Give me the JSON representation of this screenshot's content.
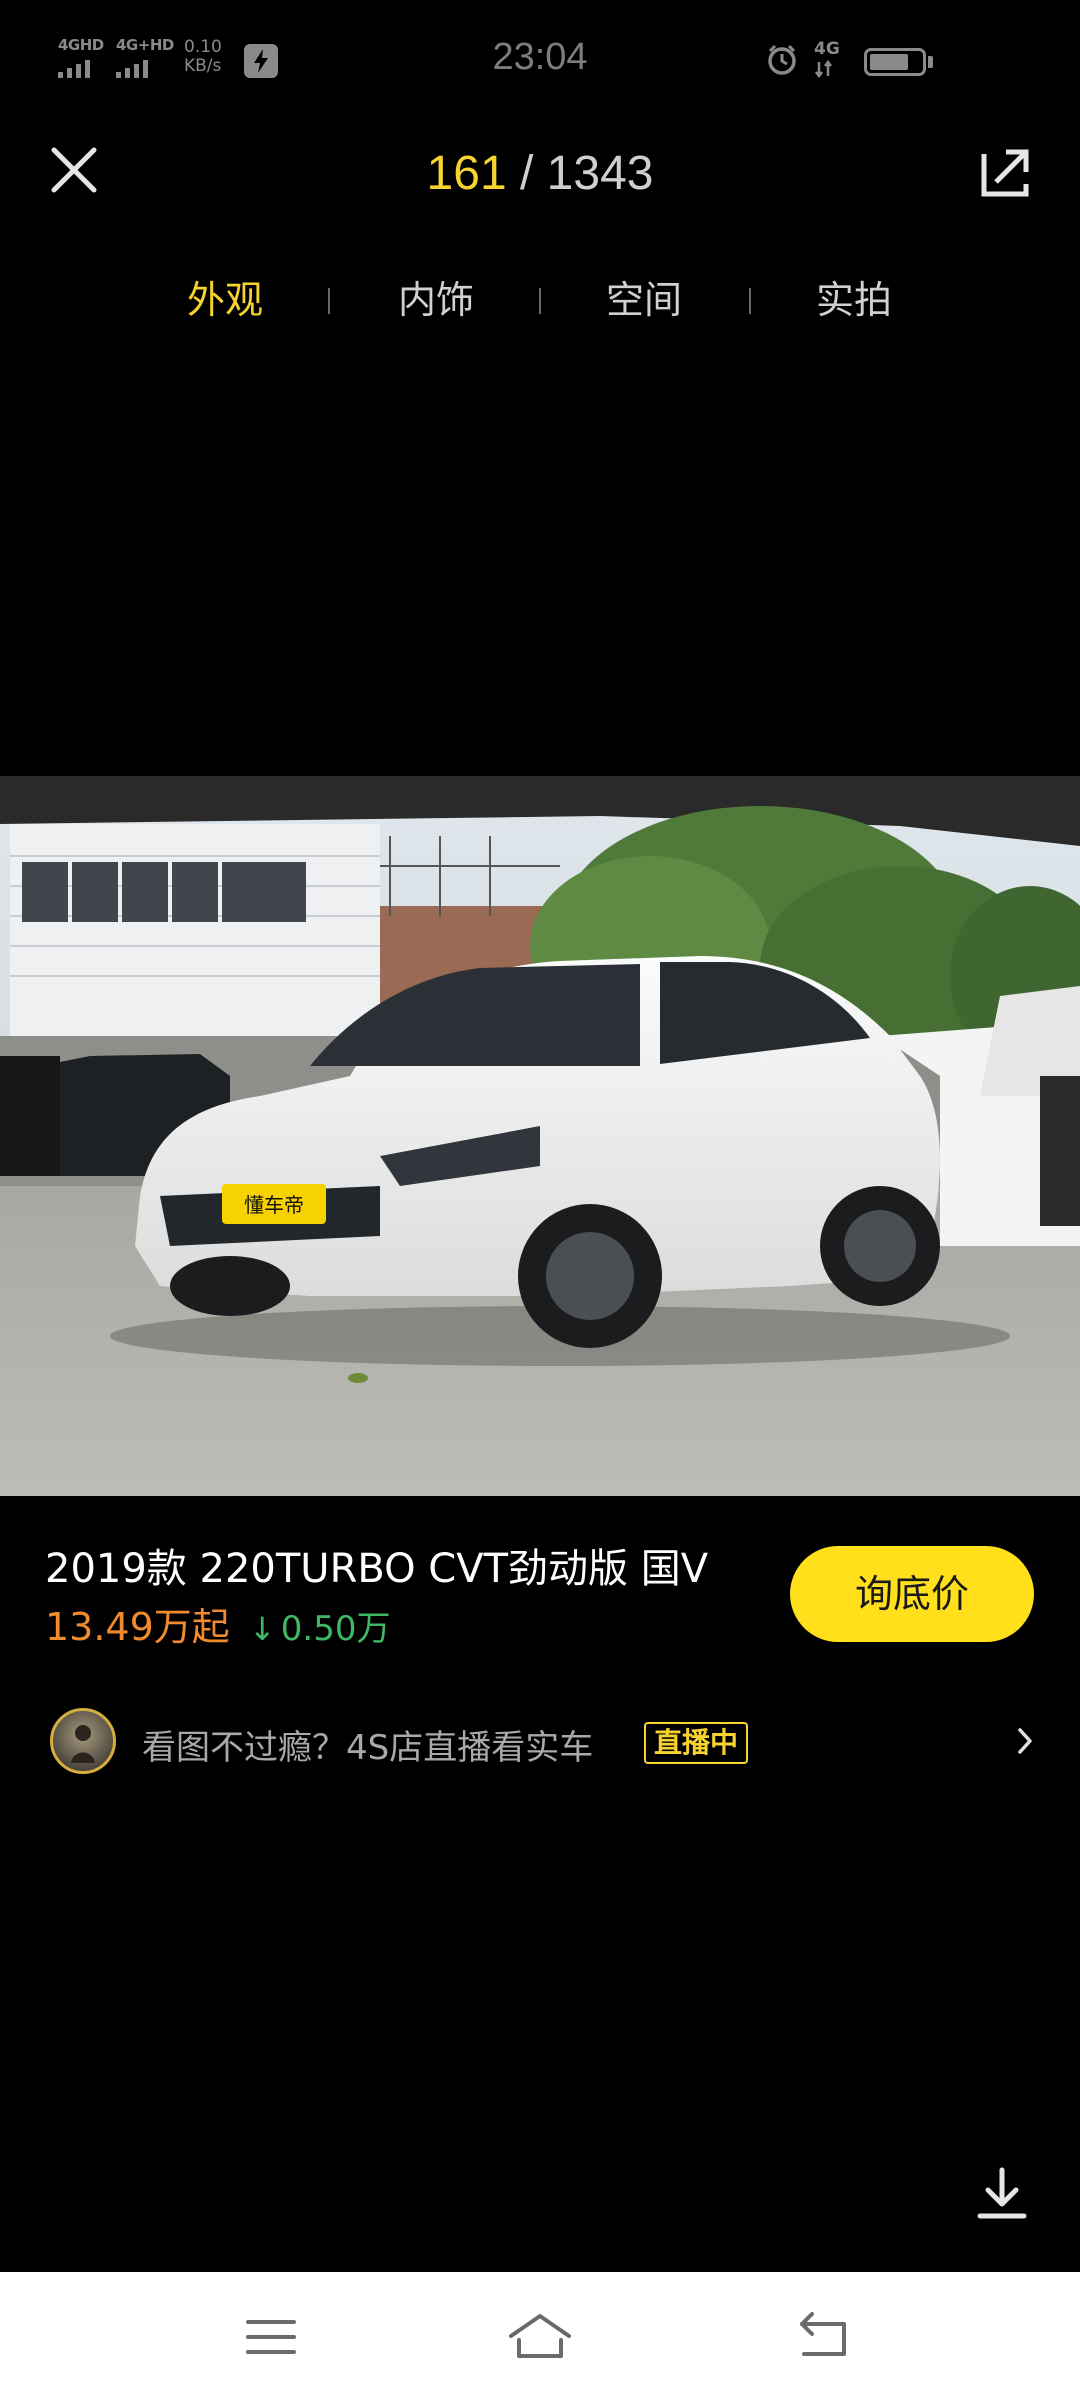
{
  "status_bar": {
    "sim1_label": "4GHD",
    "sim2_label": "4G+HD",
    "net_speed_value": "0.10",
    "net_speed_unit": "KB/s",
    "time": "23:04",
    "network_type": "4G",
    "icons": [
      "signal-icon",
      "flash-icon",
      "alarm-icon",
      "battery-icon"
    ],
    "battery_level": 0.75
  },
  "viewer": {
    "current_index": "161",
    "separator": "/",
    "total": "1343",
    "close_icon": "close-icon",
    "share_icon": "share-icon",
    "download_icon": "download-icon"
  },
  "tabs": [
    {
      "label": "外观",
      "active": true
    },
    {
      "label": "内饰",
      "active": false
    },
    {
      "label": "空间",
      "active": false
    },
    {
      "label": "实拍",
      "active": false
    }
  ],
  "photo": {
    "watermark_text": "懂车帝"
  },
  "car": {
    "title": "2019款 220TURBO CVT劲动版 国V",
    "price": "13.49万起",
    "price_drop_arrow": "↓",
    "price_drop": "0.50万"
  },
  "cta": {
    "ask_price_label": "询底价"
  },
  "live": {
    "text": "看图不过瘾？4S店直播看实车",
    "badge": "直播中"
  },
  "nav": {
    "icons": [
      "menu-icon",
      "home-icon",
      "back-icon"
    ]
  },
  "colors": {
    "accent_yellow": "#f7d32e",
    "button_yellow": "#ffe01a",
    "price_orange": "#f08a2e",
    "drop_green": "#3fb865",
    "background": "#000000"
  }
}
